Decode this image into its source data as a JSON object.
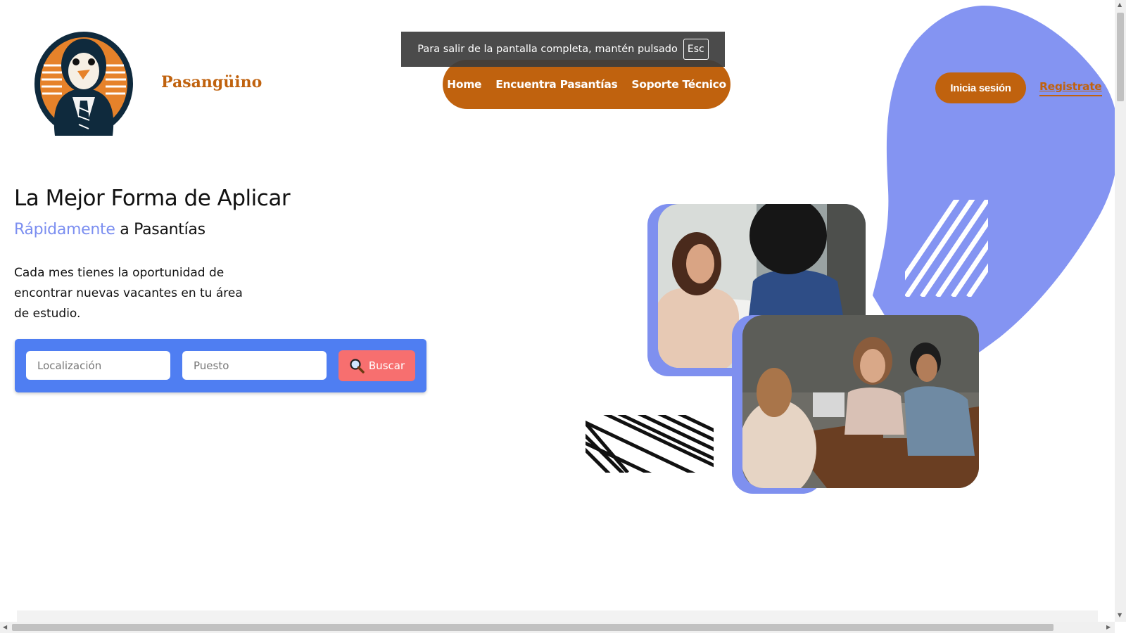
{
  "brand": {
    "name": "Pasangüino",
    "color": "#c0620e"
  },
  "fullscreen_notice": {
    "text": "Para salir de la pantalla completa, mantén pulsado",
    "key": "Esc"
  },
  "nav": {
    "items": [
      {
        "label": "Home"
      },
      {
        "label": "Encuentra Pasantías"
      },
      {
        "label": "Soporte Técnico"
      }
    ]
  },
  "auth": {
    "login_label": "Inicia sesión",
    "register_label": "Registrate"
  },
  "hero": {
    "title": "La Mejor Forma de Aplicar",
    "subtitle_accent": "Rápidamente",
    "subtitle_rest": " a Pasantías",
    "description": "Cada mes tienes la oportunidad de encontrar nuevas vacantes en tu área de estudio."
  },
  "search": {
    "location_placeholder": "Localización",
    "position_placeholder": "Puesto",
    "button_label": "Buscar",
    "button_icon": "magnifier-icon"
  },
  "colors": {
    "accent_orange": "#c0620e",
    "blob_purple": "#8494f2",
    "search_blue": "#4f7ef2",
    "search_button": "#f76f6f",
    "subtitle_accent": "#7b8ef0"
  }
}
